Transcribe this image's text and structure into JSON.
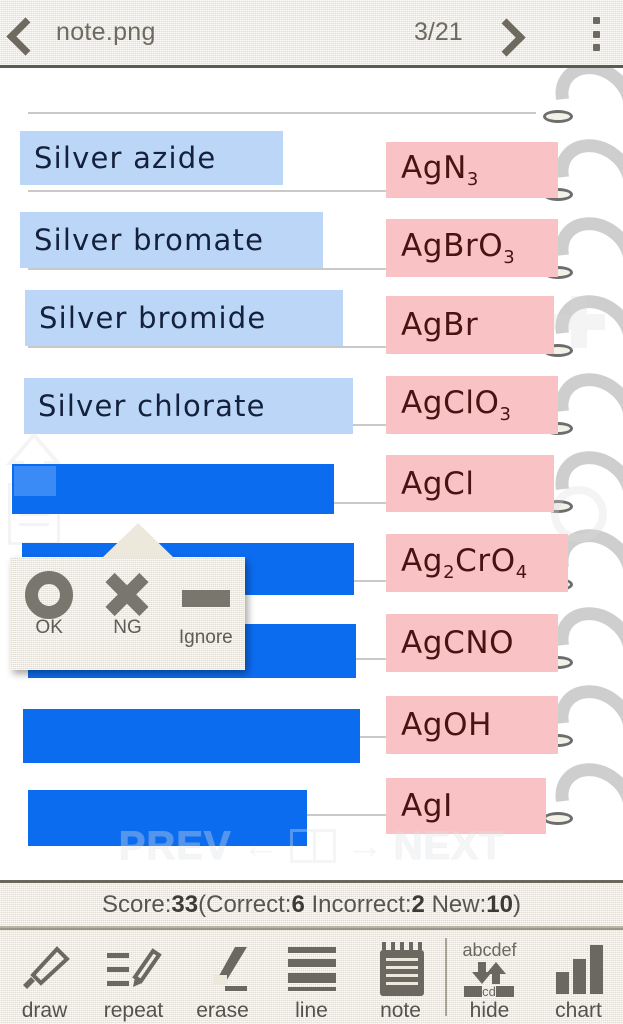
{
  "header": {
    "back_icon": "chevron-left-icon",
    "title": "note.png",
    "page_indicator": "3/21",
    "next_icon": "chevron-right-icon",
    "menu_icon": "overflow-menu-icon"
  },
  "note": {
    "rows": [
      {
        "term": "Silver azide",
        "formula_main": "AgN",
        "formula_sub": "3",
        "formula_tail": "",
        "masked": false,
        "term_width": 263,
        "formula_width": 172
      },
      {
        "term": "Silver bromate",
        "formula_main": "AgBrO",
        "formula_sub": "3",
        "formula_tail": "",
        "masked": false,
        "term_width": 303,
        "formula_width": 172
      },
      {
        "term": "Silver bromide",
        "formula_main": "AgBr",
        "formula_sub": "",
        "formula_tail": "",
        "masked": false,
        "term_width": 318,
        "formula_width": 168
      },
      {
        "term": "Silver chlorate",
        "formula_main": "AgClO",
        "formula_sub": "3",
        "formula_tail": "",
        "masked": false,
        "term_width": 329,
        "formula_width": 172
      },
      {
        "term": "",
        "formula_main": "AgCl",
        "formula_sub": "",
        "formula_tail": "",
        "masked": true,
        "term_width": 310,
        "formula_width": 168
      },
      {
        "term": "",
        "formula_main": "Ag",
        "formula_sub": "2",
        "formula_tail": "CrO",
        "formula_sub2": "4",
        "masked": true,
        "term_width": 332,
        "formula_width": 182
      },
      {
        "term": "",
        "formula_main": "AgCNO",
        "formula_sub": "",
        "formula_tail": "",
        "masked": true,
        "term_width": 328,
        "formula_width": 172
      },
      {
        "term": "",
        "formula_main": "AgOH",
        "formula_sub": "",
        "formula_tail": "",
        "masked": true,
        "term_width": 337,
        "formula_width": 172
      },
      {
        "term": "",
        "formula_main": "AgI",
        "formula_sub": "",
        "formula_tail": "",
        "masked": true,
        "term_width": 279,
        "formula_width": 160
      }
    ],
    "watermark": {
      "prev_label": "PREV",
      "prev_arrow": "←",
      "book_icon": "book-icon",
      "next_arrow": "→",
      "next_label": "NEXT"
    },
    "colors": {
      "term_highlight": "#bcd6f7",
      "formula_highlight": "#f9c3c5",
      "mask_blue": "#0c6cf0",
      "term_ink": "#14213d",
      "formula_ink": "#4a1212"
    }
  },
  "judge_popup": {
    "options": [
      {
        "icon": "circle-ok-icon",
        "label": "OK"
      },
      {
        "icon": "cross-ng-icon",
        "label": "NG"
      },
      {
        "icon": "dash-ignore-icon",
        "label": "Ignore"
      }
    ]
  },
  "score": {
    "score_label": "Score:",
    "score_value": "33",
    "open_paren": "(",
    "correct_label": "Correct:",
    "correct_value": "6",
    "space1": " ",
    "incorrect_label": "Incorrect:",
    "incorrect_value": "2",
    "space2": " ",
    "new_label": "New:",
    "new_value": "10",
    "close_paren": ")"
  },
  "toolbar": {
    "items": [
      {
        "icon": "marker-pen-icon",
        "label": "draw"
      },
      {
        "icon": "repeat-pen-icon",
        "label": "repeat"
      },
      {
        "icon": "eraser-icon",
        "label": "erase"
      },
      {
        "icon": "lines-icon",
        "label": "line"
      },
      {
        "icon": "notepad-icon",
        "label": "note"
      },
      {
        "icon": "hide-abcdef-icon",
        "label": "hide",
        "icon_top_text": "abcdef",
        "icon_mid_text": "cd"
      },
      {
        "icon": "bar-chart-icon",
        "label": "chart"
      }
    ]
  }
}
